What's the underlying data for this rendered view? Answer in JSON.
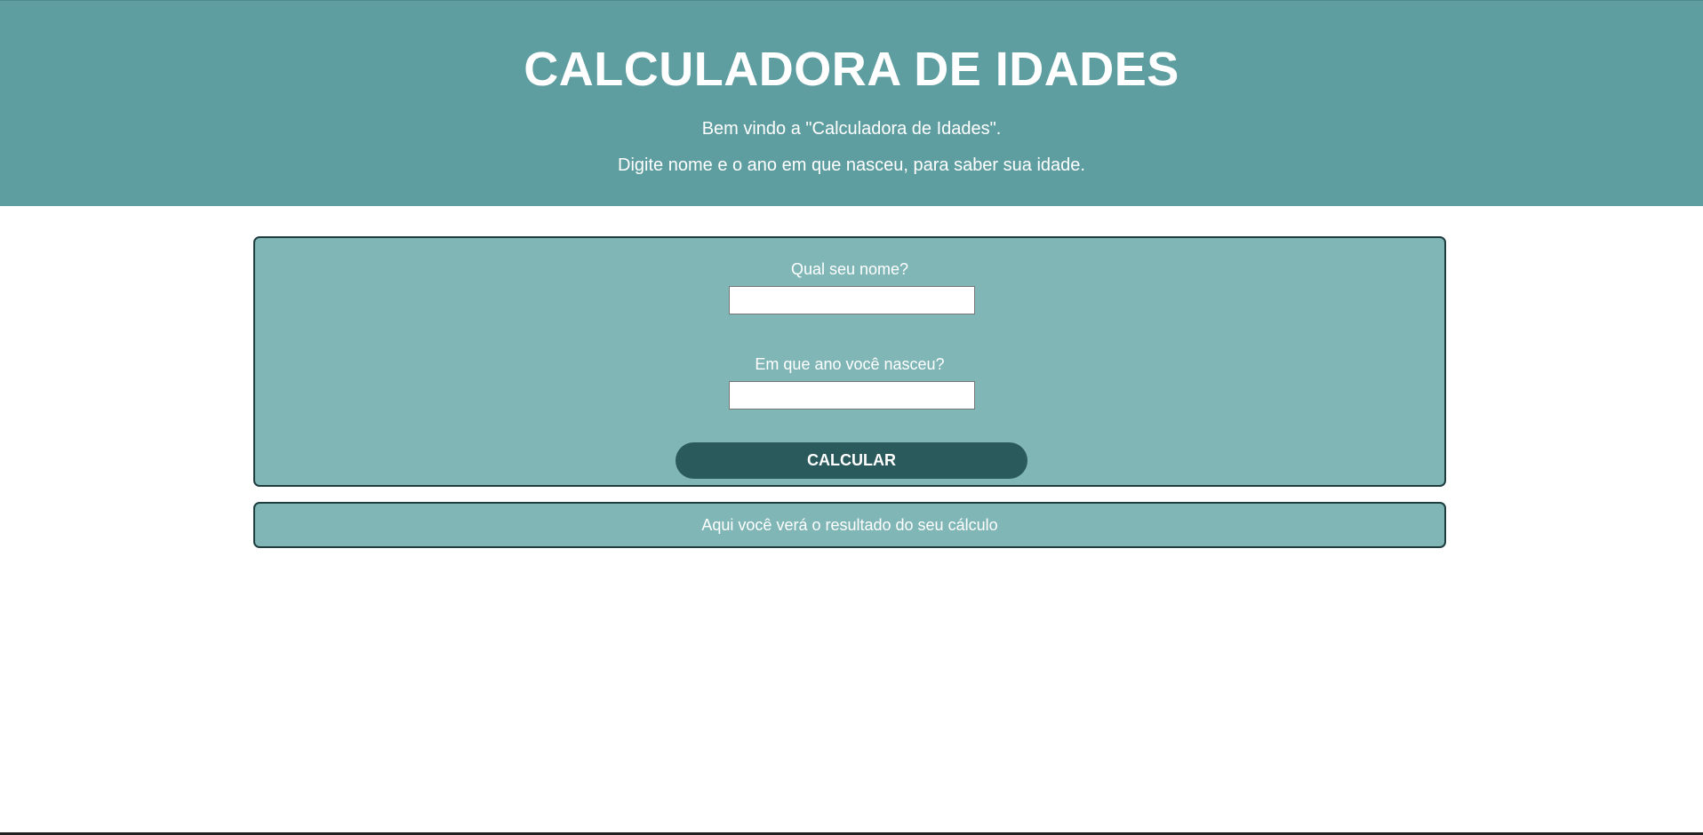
{
  "header": {
    "title": "CALCULADORA DE IDADES",
    "welcome": "Bem vindo a \"Calculadora de Idades\".",
    "instructions": "Digite nome e o ano em que nasceu, para saber sua idade."
  },
  "form": {
    "name_label": "Qual seu nome?",
    "name_value": "",
    "year_label": "Em que ano você nasceu?",
    "year_value": "",
    "button_label": "CALCULAR"
  },
  "result": {
    "text": "Aqui você verá o resultado do seu cálculo"
  },
  "colors": {
    "header_bg": "#5f9ea0",
    "panel_bg": "#81b6b7",
    "panel_border": "#1f3d3e",
    "button_bg": "#2b5a5c",
    "text": "#ffffff"
  }
}
